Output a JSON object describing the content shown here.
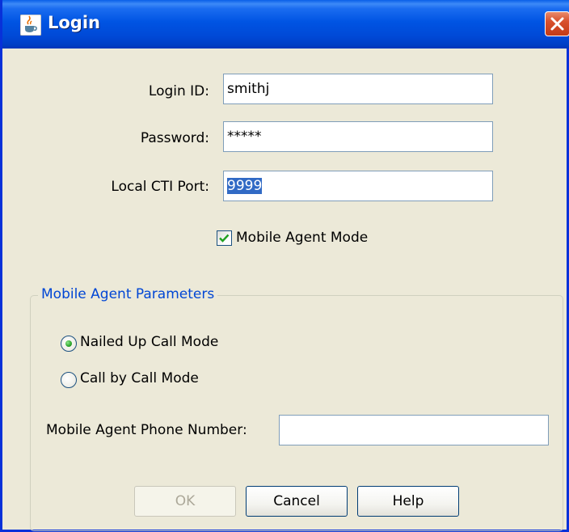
{
  "window": {
    "title": "Login",
    "close_label": "✕"
  },
  "form": {
    "login_id_label": "Login ID:",
    "login_id_value": "smithj",
    "password_label": "Password:",
    "password_value": "*****",
    "cti_port_label": "Local CTI Port:",
    "cti_port_value": "9999",
    "mobile_mode_label": "Mobile Agent Mode",
    "mobile_mode_checked": true
  },
  "params": {
    "title": "Mobile Agent Parameters",
    "nailed_up_label": "Nailed Up Call Mode",
    "call_by_call_label": "Call by Call Mode",
    "selected_mode": "nailed_up",
    "phone_label": "Mobile Agent Phone Number:",
    "phone_value": ""
  },
  "buttons": {
    "ok": "OK",
    "cancel": "Cancel",
    "help": "Help"
  },
  "icons": {
    "app": "java-cup-icon",
    "close": "close-icon",
    "check": "checkmark-icon"
  }
}
